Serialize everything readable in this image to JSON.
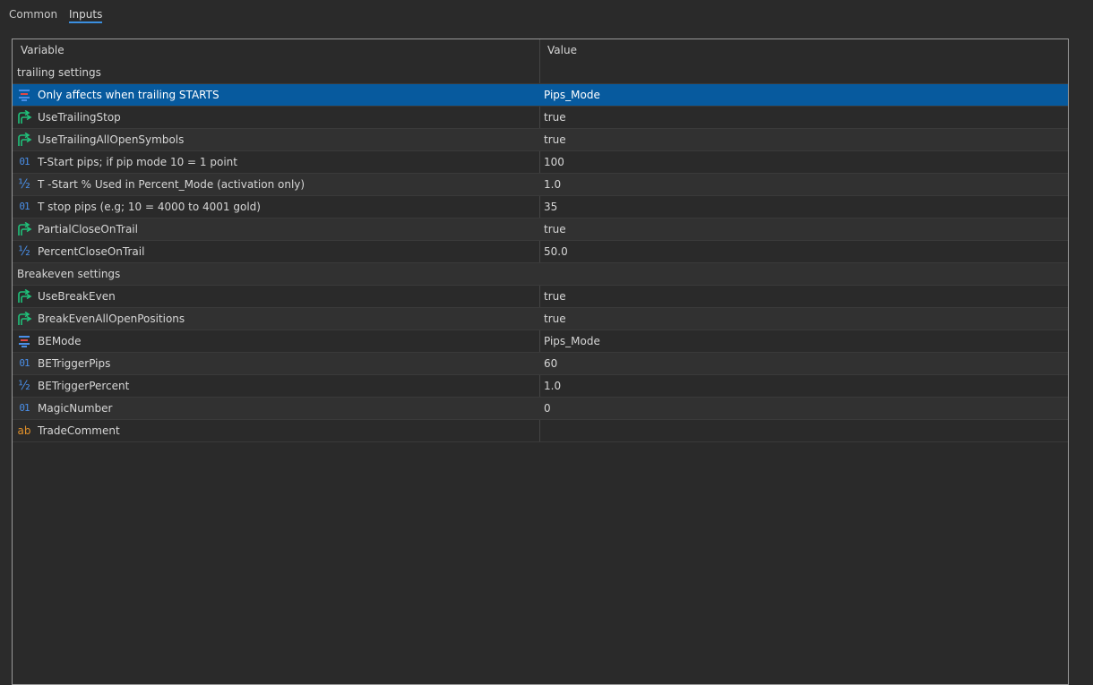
{
  "tabs": [
    {
      "label": "Common",
      "active": false
    },
    {
      "label": "Inputs",
      "active": true
    }
  ],
  "columns": {
    "variable": "Variable",
    "value": "Value"
  },
  "rows": [
    {
      "kind": "group",
      "variable": "trailing settings",
      "value": ""
    },
    {
      "kind": "param",
      "type": "enum",
      "variable": "Only affects when trailing STARTS",
      "value": "Pips_Mode",
      "selected": true
    },
    {
      "kind": "param",
      "type": "bool",
      "variable": "UseTrailingStop",
      "value": "true"
    },
    {
      "kind": "param",
      "type": "bool",
      "variable": "UseTrailingAllOpenSymbols",
      "value": "true"
    },
    {
      "kind": "param",
      "type": "int",
      "variable": "T-Start pips; if pip mode 10 = 1 point",
      "value": "100"
    },
    {
      "kind": "param",
      "type": "double",
      "variable": "T -Start % Used in Percent_Mode (activation only)",
      "value": "1.0"
    },
    {
      "kind": "param",
      "type": "int",
      "variable": "T stop pips (e.g; 10 = 4000 to 4001 gold)",
      "value": "35"
    },
    {
      "kind": "param",
      "type": "bool",
      "variable": "PartialCloseOnTrail",
      "value": "true"
    },
    {
      "kind": "param",
      "type": "double",
      "variable": "PercentCloseOnTrail",
      "value": "50.0"
    },
    {
      "kind": "group",
      "variable": "Breakeven settings",
      "value": ""
    },
    {
      "kind": "param",
      "type": "bool",
      "variable": "UseBreakEven",
      "value": "true"
    },
    {
      "kind": "param",
      "type": "bool",
      "variable": "BreakEvenAllOpenPositions",
      "value": "true"
    },
    {
      "kind": "param",
      "type": "enum",
      "variable": "BEMode",
      "value": "Pips_Mode"
    },
    {
      "kind": "param",
      "type": "int",
      "variable": "BETriggerPips",
      "value": "60"
    },
    {
      "kind": "param",
      "type": "double",
      "variable": "BETriggerPercent",
      "value": "1.0"
    },
    {
      "kind": "param",
      "type": "int",
      "variable": "MagicNumber",
      "value": "0"
    },
    {
      "kind": "param",
      "type": "string",
      "variable": "TradeComment",
      "value": ""
    }
  ],
  "icons": {
    "int": {
      "name": "integer-type-icon",
      "glyph": "01",
      "color": "#4a8fe8"
    },
    "double": {
      "name": "fraction-type-icon",
      "glyph": "½",
      "color": "#4a8fe8"
    },
    "bool": {
      "name": "boolean-type-icon",
      "color": "#1fc27a"
    },
    "enum": {
      "name": "enumeration-type-icon",
      "color": "#4a8fe8"
    },
    "string": {
      "name": "string-type-icon",
      "glyph": "ab",
      "color": "#e0902a"
    }
  },
  "colors": {
    "selection": "#075a9e",
    "tab_accent": "#3b8fe0",
    "background": "#2b2b2b"
  }
}
